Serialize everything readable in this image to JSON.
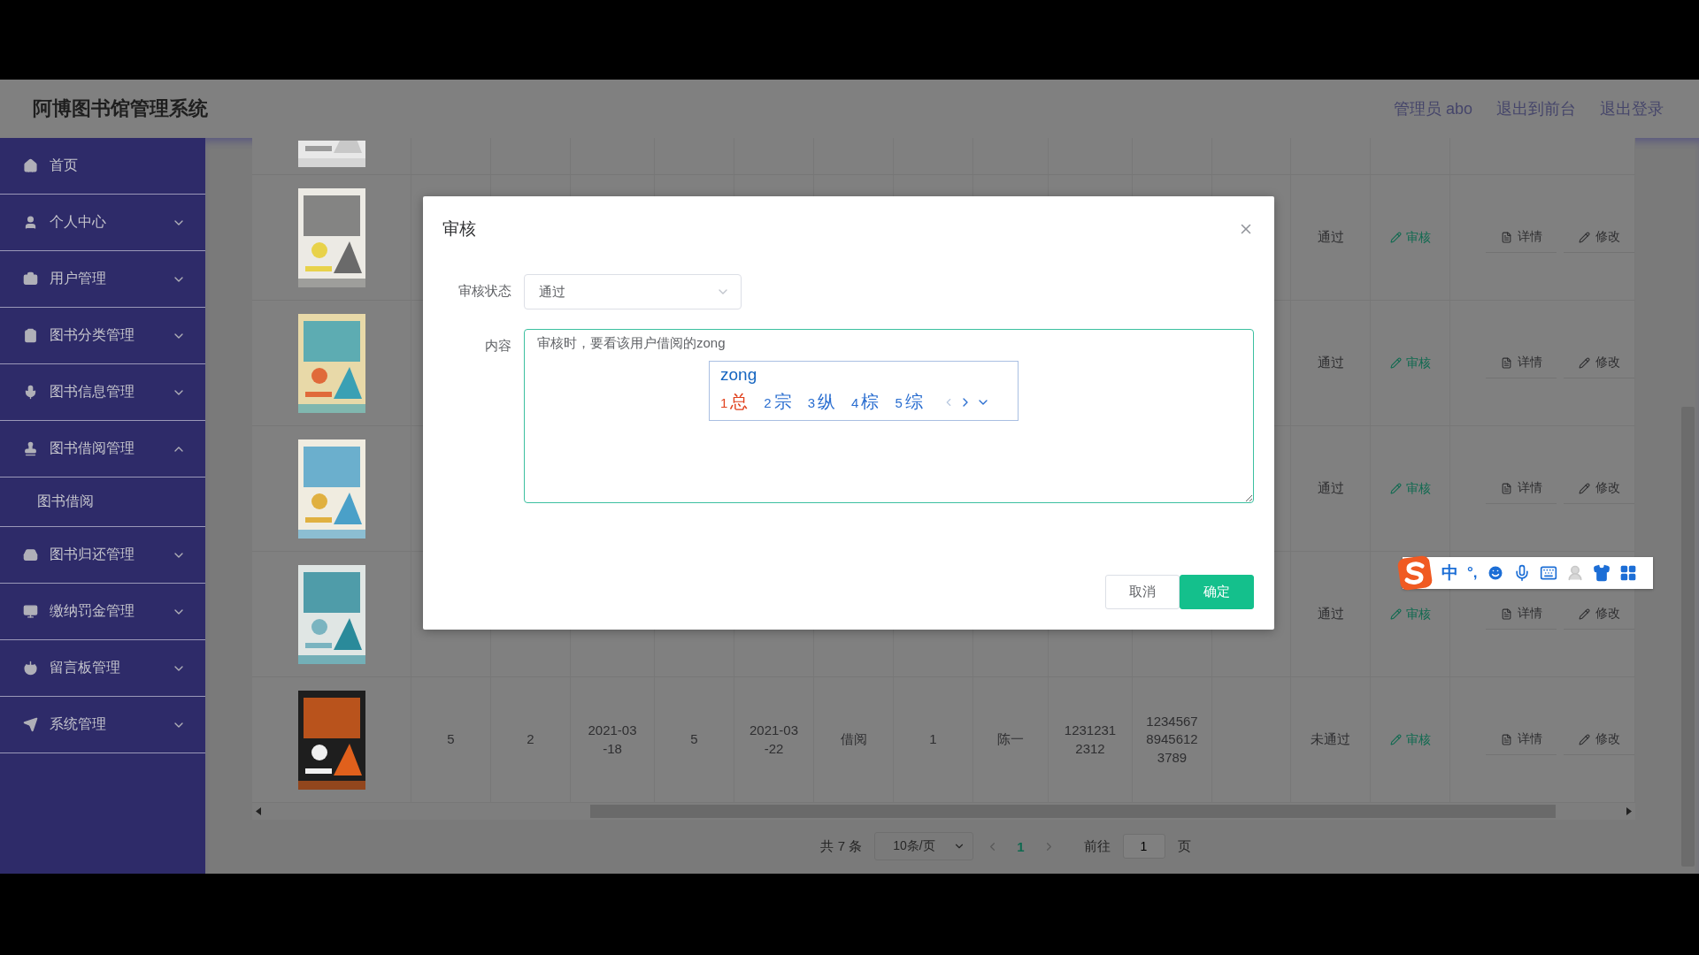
{
  "header": {
    "title": "阿博图书馆管理系统",
    "links": [
      "管理员 abo",
      "退出到前台",
      "退出登录"
    ]
  },
  "sidebar": {
    "items": [
      {
        "label": "首页",
        "kind": "link"
      },
      {
        "label": "个人中心",
        "kind": "group",
        "expanded": false
      },
      {
        "label": "用户管理",
        "kind": "group",
        "expanded": false
      },
      {
        "label": "图书分类管理",
        "kind": "group",
        "expanded": false
      },
      {
        "label": "图书信息管理",
        "kind": "group",
        "expanded": false
      },
      {
        "label": "图书借阅管理",
        "kind": "group",
        "expanded": true,
        "children": [
          {
            "label": "图书借阅"
          }
        ]
      },
      {
        "label": "图书归还管理",
        "kind": "group",
        "expanded": false
      },
      {
        "label": "缴纳罚金管理",
        "kind": "group",
        "expanded": false
      },
      {
        "label": "留言板管理",
        "kind": "group",
        "expanded": false
      },
      {
        "label": "系统管理",
        "kind": "group",
        "expanded": false
      }
    ]
  },
  "table": {
    "rows": [
      {
        "kind": "cut"
      },
      {
        "kind": "full",
        "status": "通过",
        "audit": "审核",
        "detail": "详情",
        "edit": "修改"
      },
      {
        "kind": "full",
        "status": "通过",
        "audit": "审核",
        "detail": "详情",
        "edit": "修改"
      },
      {
        "kind": "full",
        "status": "通过",
        "audit": "审核",
        "detail": "详情",
        "edit": "修改"
      },
      {
        "kind": "full",
        "status": "通过",
        "audit": "审核",
        "detail": "详情",
        "edit": "修改"
      },
      {
        "kind": "full",
        "cells": [
          "5",
          "2",
          "2021-03-18",
          "5",
          "2021-03-22",
          "借阅",
          "1",
          "陈一",
          "12312312312",
          "123456789456123789"
        ],
        "status": "未通过",
        "audit": "审核",
        "detail": "详情",
        "edit": "修改"
      }
    ]
  },
  "pagination": {
    "total": "共 7 条",
    "page_size": "10条/页",
    "pages": [
      {
        "label": "1",
        "selected": true
      }
    ],
    "goto_label": "前往",
    "goto_value": "1",
    "goto_suffix": "页"
  },
  "dialog": {
    "title": "审核",
    "fields": [
      {
        "kind": "select",
        "label": "审核状态",
        "value": "通过"
      },
      {
        "kind": "textarea",
        "label": "内容",
        "value": "审核时，要看该用户借阅的zong"
      }
    ],
    "buttons": [
      {
        "label": "取消",
        "kind": "default"
      },
      {
        "label": "确定",
        "kind": "primary"
      }
    ]
  },
  "ime": {
    "composition": "zong",
    "candidates": [
      {
        "index": "1",
        "text": "总",
        "selected": true
      },
      {
        "index": "2",
        "text": "宗",
        "selected": false
      },
      {
        "index": "3",
        "text": "纵",
        "selected": false
      },
      {
        "index": "4",
        "text": "棕",
        "selected": false
      },
      {
        "index": "5",
        "text": "综",
        "selected": false
      }
    ]
  },
  "ime_toolbar": {
    "mode": "中",
    "punct": "°,"
  }
}
